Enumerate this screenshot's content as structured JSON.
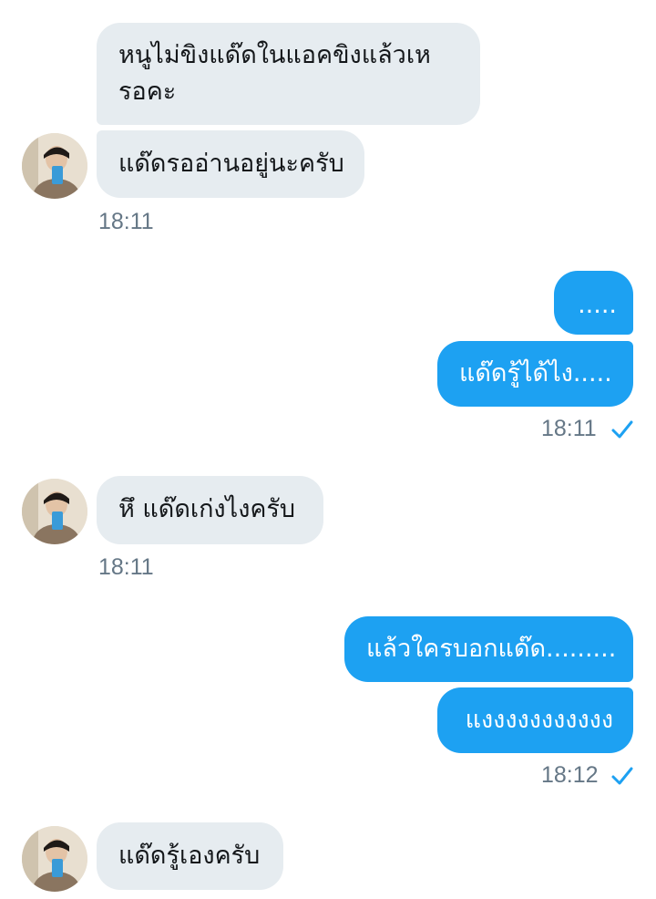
{
  "messages": [
    {
      "id": "m1",
      "direction": "in",
      "text": "หนูไม่ขิงแด๊ดในแอคขิงแล้วเหรอคะ",
      "line1": "หนูไม่ขิงแด๊ดในแอคขิงแล้วเห",
      "line2": "รอคะ"
    },
    {
      "id": "m2",
      "direction": "in",
      "text": "แด๊ดรออ่านอยู่นะครับ"
    },
    {
      "id": "m3",
      "direction": "out",
      "text": "....."
    },
    {
      "id": "m4",
      "direction": "out",
      "text": "แด๊ดรู้ได้ไง....."
    },
    {
      "id": "m5",
      "direction": "in",
      "text": "หึ แด๊ดเก่งไงครับ"
    },
    {
      "id": "m6",
      "direction": "out",
      "text": "แล้วใครบอกแด๊ด........."
    },
    {
      "id": "m7",
      "direction": "out",
      "text": "แงงงงงงงงงงง"
    },
    {
      "id": "m8",
      "direction": "in",
      "text": "แด๊ดรู้เองครับ"
    }
  ],
  "timestamps": {
    "t1": "18:11",
    "t2": "18:11",
    "t3": "18:11",
    "t4": "18:12"
  },
  "icons": {
    "read_receipt": "checkmark-icon",
    "avatar": "user-avatar"
  },
  "colors": {
    "incoming_bubble": "#e6ecf0",
    "outgoing_bubble": "#1da1f2",
    "timestamp": "#657786",
    "check": "#1da1f2"
  }
}
